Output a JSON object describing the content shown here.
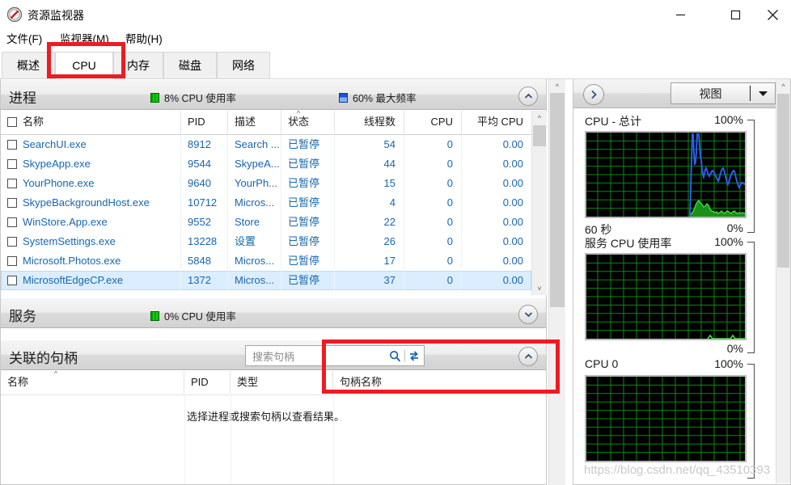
{
  "window": {
    "title": "资源监视器",
    "icon": "resource-monitor-icon",
    "minimize": "最小化",
    "maximize": "最大化",
    "close": "关闭"
  },
  "menu": {
    "items": [
      {
        "label": "文件(F)"
      },
      {
        "label": "监视器(M)"
      },
      {
        "label": "帮助(H)"
      }
    ]
  },
  "tabs": {
    "selected": "CPU",
    "items": [
      {
        "label": "概述"
      },
      {
        "label": "CPU"
      },
      {
        "label": "内存"
      },
      {
        "label": "磁盘"
      },
      {
        "label": "网络"
      }
    ]
  },
  "processes": {
    "title": "进程",
    "stat_cpu": "8% CPU 使用率",
    "stat_freq": "60% 最大频率",
    "collapse_icon": "chevron-up-icon",
    "columns": [
      {
        "label": "名称",
        "align": "left"
      },
      {
        "label": "PID",
        "align": "left"
      },
      {
        "label": "描述",
        "align": "left"
      },
      {
        "label": "状态",
        "align": "left",
        "sorted": "asc"
      },
      {
        "label": "线程数",
        "align": "right"
      },
      {
        "label": "CPU",
        "align": "right"
      },
      {
        "label": "平均 CPU",
        "align": "right"
      }
    ],
    "rows": [
      {
        "name": "SearchUI.exe",
        "pid": "8912",
        "desc": "Search ...",
        "status": "已暂停",
        "threads": "54",
        "cpu": "0",
        "avg": "0.00",
        "selected": false
      },
      {
        "name": "SkypeApp.exe",
        "pid": "9544",
        "desc": "SkypeA...",
        "status": "已暂停",
        "threads": "44",
        "cpu": "0",
        "avg": "0.00",
        "selected": false
      },
      {
        "name": "YourPhone.exe",
        "pid": "9640",
        "desc": "YourPh...",
        "status": "已暂停",
        "threads": "15",
        "cpu": "0",
        "avg": "0.00",
        "selected": false
      },
      {
        "name": "SkypeBackgroundHost.exe",
        "pid": "10712",
        "desc": "Micros...",
        "status": "已暂停",
        "threads": "4",
        "cpu": "0",
        "avg": "0.00",
        "selected": false
      },
      {
        "name": "WinStore.App.exe",
        "pid": "9552",
        "desc": "Store",
        "status": "已暂停",
        "threads": "22",
        "cpu": "0",
        "avg": "0.00",
        "selected": false
      },
      {
        "name": "SystemSettings.exe",
        "pid": "13228",
        "desc": "设置",
        "status": "已暂停",
        "threads": "26",
        "cpu": "0",
        "avg": "0.00",
        "selected": false
      },
      {
        "name": "Microsoft.Photos.exe",
        "pid": "5848",
        "desc": "Micros...",
        "status": "已暂停",
        "threads": "17",
        "cpu": "0",
        "avg": "0.00",
        "selected": false
      },
      {
        "name": "MicrosoftEdgeCP.exe",
        "pid": "1372",
        "desc": "Micros...",
        "status": "已暂停",
        "threads": "37",
        "cpu": "0",
        "avg": "0.00",
        "selected": true
      }
    ]
  },
  "services": {
    "title": "服务",
    "stat_cpu": "0% CPU 使用率",
    "expand_icon": "chevron-down-icon"
  },
  "handles": {
    "title": "关联的句柄",
    "collapse_icon": "chevron-up-icon",
    "search": {
      "placeholder": "搜索句柄",
      "value": "",
      "search_icon": "magnifier-icon",
      "refresh_icon": "swap-arrows-icon"
    },
    "columns": [
      {
        "label": "名称",
        "sorted": "asc"
      },
      {
        "label": "PID"
      },
      {
        "label": "类型"
      },
      {
        "label": "句柄名称"
      }
    ],
    "empty_message": "选择进程或搜索句柄以查看结果。"
  },
  "right_panel": {
    "expand_icon": "chevron-right-icon",
    "view_button": {
      "label": "视图",
      "caret_icon": "caret-down-icon"
    },
    "graphs": [
      {
        "title": "CPU - 总计",
        "max": "100%",
        "min": "0%",
        "bottom_left": "60 秒",
        "has_data": true
      },
      {
        "title": "服务 CPU 使用率",
        "max": "100%",
        "min": "0%",
        "bottom_left": "",
        "has_data": false
      },
      {
        "title": "CPU 0",
        "max": "100%",
        "min": "",
        "bottom_left": "",
        "has_data": false
      }
    ]
  },
  "annotations": {
    "highlight_tab": "CPU",
    "highlight_search": "搜索句柄",
    "watermark": "https://blog.csdn.net/qq_43510393",
    "red": "#ee1b23"
  },
  "chart_data": {
    "type": "line",
    "title": "CPU - 总计",
    "xlabel": "60 秒",
    "ylabel": "%",
    "ylim": [
      0,
      100
    ],
    "grid": true,
    "series": [
      {
        "name": "最大频率",
        "color": "#1f5fe0",
        "values": [
          0,
          0,
          0,
          0,
          0,
          0,
          0,
          0,
          0,
          0,
          0,
          0,
          0,
          0,
          0,
          0,
          0,
          0,
          0,
          0,
          0,
          0,
          0,
          0,
          0,
          0,
          0,
          0,
          0,
          0,
          0,
          0,
          0,
          0,
          0,
          0,
          0,
          0,
          0,
          0,
          0,
          0,
          0,
          62,
          100,
          98,
          64,
          68,
          100,
          100,
          76,
          58,
          60,
          66,
          62,
          58,
          52,
          56,
          62,
          48,
          44,
          52,
          58,
          50,
          42
        ]
      },
      {
        "name": "CPU 使用率",
        "color": "#35d63a",
        "values": [
          0,
          0,
          0,
          0,
          0,
          0,
          0,
          0,
          0,
          0,
          0,
          0,
          0,
          0,
          0,
          0,
          0,
          0,
          0,
          0,
          0,
          0,
          0,
          0,
          0,
          0,
          0,
          0,
          0,
          0,
          0,
          0,
          0,
          0,
          0,
          0,
          0,
          0,
          0,
          0,
          0,
          0,
          0,
          4,
          12,
          14,
          10,
          9,
          16,
          13,
          8,
          5,
          6,
          5,
          4,
          3,
          5,
          6,
          4,
          3,
          6,
          7,
          4,
          3,
          5
        ]
      }
    ]
  }
}
